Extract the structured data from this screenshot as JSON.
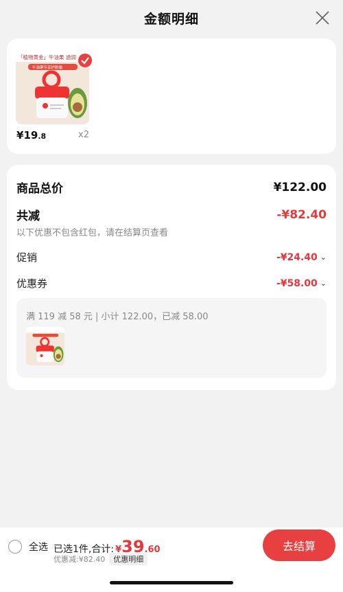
{
  "header": {
    "title": "金额明细"
  },
  "product": {
    "price_symbol": "¥",
    "price_int": "19",
    "price_dec": ".8",
    "qty": "x2",
    "image_text": "「植物黄金」牛油果 透润",
    "image_subtext": "牛油果专享护肤霜"
  },
  "summary": {
    "total_label": "商品总价",
    "total_value": "¥122.00",
    "reduce_label": "共减",
    "reduce_value": "-¥82.40",
    "hint": "以下优惠不包含红包，请在结算页查看",
    "promo_label": "促销",
    "promo_value": "-¥24.40",
    "coupon_label": "优惠券",
    "coupon_value": "-¥58.00",
    "coupon_detail": "满 119 减 58 元 | 小计 122.00，已减 58.00",
    "chevron": "⌄"
  },
  "bottom": {
    "select_all": "全选",
    "selected_text": "已选1件,合计:",
    "sum_symbol": "¥",
    "sum_int": "39",
    "sum_dec": ".60",
    "discount_text": "优惠减:¥82.40",
    "detail_tag": "优惠明细",
    "checkout": "去结算"
  },
  "colors": {
    "accent": "#e84040",
    "price_red": "#e4393c"
  }
}
